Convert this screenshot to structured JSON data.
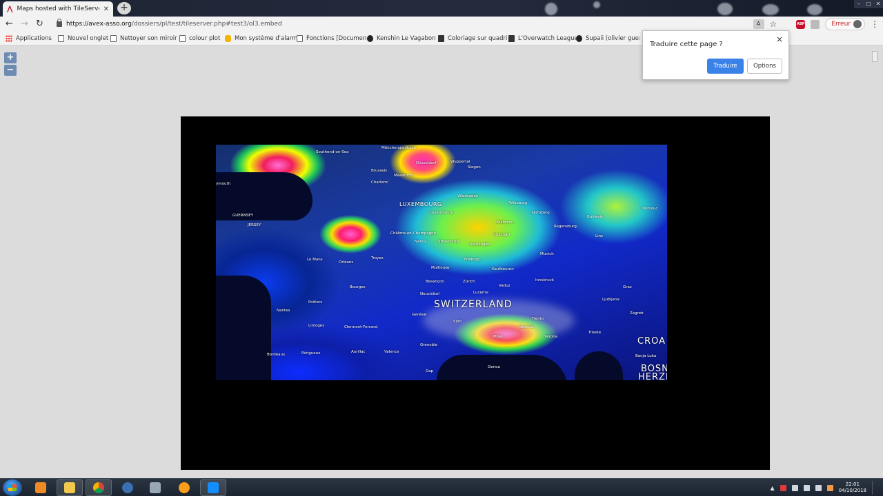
{
  "browser": {
    "tab_title": "Maps hosted with TileServer-php",
    "new_tab_label": "+",
    "url_domain": "https://avex-asso.org",
    "url_path": "/dossiers/pl/test/tileserver.php#test3/ol3.embed",
    "error_label": "Erreur",
    "abp_label": "ABP"
  },
  "bookmarks": [
    {
      "label": "Applications",
      "icon": "apps-grid-icon"
    },
    {
      "label": "Nouvel onglet",
      "icon": "page-icon"
    },
    {
      "label": "Nettoyer son miroir d",
      "icon": "page-icon"
    },
    {
      "label": "colour plot",
      "icon": "page-icon"
    },
    {
      "label": "Mon système d'alarm",
      "icon": "bookmark-orange-icon"
    },
    {
      "label": "Fonctions [Documen",
      "icon": "page-icon"
    },
    {
      "label": "Kenshin Le Vagabon",
      "icon": "avatar-icon"
    },
    {
      "label": "Coloriage sur quadri",
      "icon": "square-icon"
    },
    {
      "label": "L'Overwatch League",
      "icon": "flag-icon"
    },
    {
      "label": "Supaii (olivier gueroi",
      "icon": "github-icon"
    }
  ],
  "map": {
    "zoom_in_label": "+",
    "zoom_out_label": "−",
    "labels": {
      "southend": "Southend-on-Sea",
      "moenchengladbach": "Mönchengladbach",
      "dusseldorf": "Düsseldorf",
      "wuppertal": "Wuppertal",
      "siegen": "Siegen",
      "maastricht": "Maastricht",
      "charleroi": "Charleroi",
      "brussels": "Brussels",
      "mouth": "ymouth",
      "guernsey": "GUERNSEY",
      "jersey": "JERSEY",
      "luxembourg_country": "LUXEMBOURG",
      "luxembourg_city": "Luxembourg",
      "wiesbaden": "Wiesbaden",
      "wurzburg": "Würzburg",
      "heilbronn": "Heilbronn",
      "nurnberg": "Nürnberg",
      "regensburg": "Regensburg",
      "chalons": "Châlons-en-Champagne",
      "nancy": "Nancy",
      "strasbourg": "Strasbourg",
      "stuttgart": "Stuttgart",
      "reutlingen": "Reutlingen",
      "le_mans": "Le Mans",
      "orleans": "Orléans",
      "troyes": "Troyes",
      "mulhouse": "Mulhouse",
      "munich": "Munich",
      "freiburg": "Freiburg",
      "kaufbeuren": "Kaufbeuren",
      "bourges": "Bourges",
      "besancon": "Besançon",
      "zurich": "Zürich",
      "vaduz": "Vaduz",
      "innsbruck": "Innsbruck",
      "switzerland": "SWITZERLAND",
      "neuchatel": "Neuchâtel",
      "lucerne": "Lucerne",
      "nantes": "Nantes",
      "poitiers": "Poitiers",
      "limoges": "Limoges",
      "clermont": "Clermont-Ferrand",
      "geneve": "Genève",
      "sion": "Sion",
      "trento": "Trento",
      "milan": "Milan",
      "brescia": "Brescia",
      "verona": "Verona",
      "trieste": "Trieste",
      "croatia_partial": "CROA",
      "bordeaux": "Bordeaux",
      "perigueux": "Périgueux",
      "aurillac": "Aurillac",
      "valence": "Valence",
      "grenoble": "Grenoble",
      "gap": "Gap",
      "genoa": "Genoa",
      "bosnia_partial": "BOSNI",
      "herzeg_partial": "HERZEG",
      "banja_luka": "Banja Luka",
      "budweis": "Budweis",
      "linz": "Linz",
      "graz": "Graz",
      "zagreb": "Zagreb",
      "olomouc": "Olomouc",
      "ljubljana": "Ljubljana"
    }
  },
  "translate_popup": {
    "title": "Traduire cette page ?",
    "close_label": "×",
    "translate_button": "Traduire",
    "options_button": "Options"
  },
  "taskbar": {
    "time": "22:01",
    "date": "04/10/2018",
    "apps": [
      "explorer",
      "media-player",
      "file-explorer",
      "chrome",
      "thunderbird",
      "calculator",
      "overwatch",
      "battle-net"
    ]
  }
}
